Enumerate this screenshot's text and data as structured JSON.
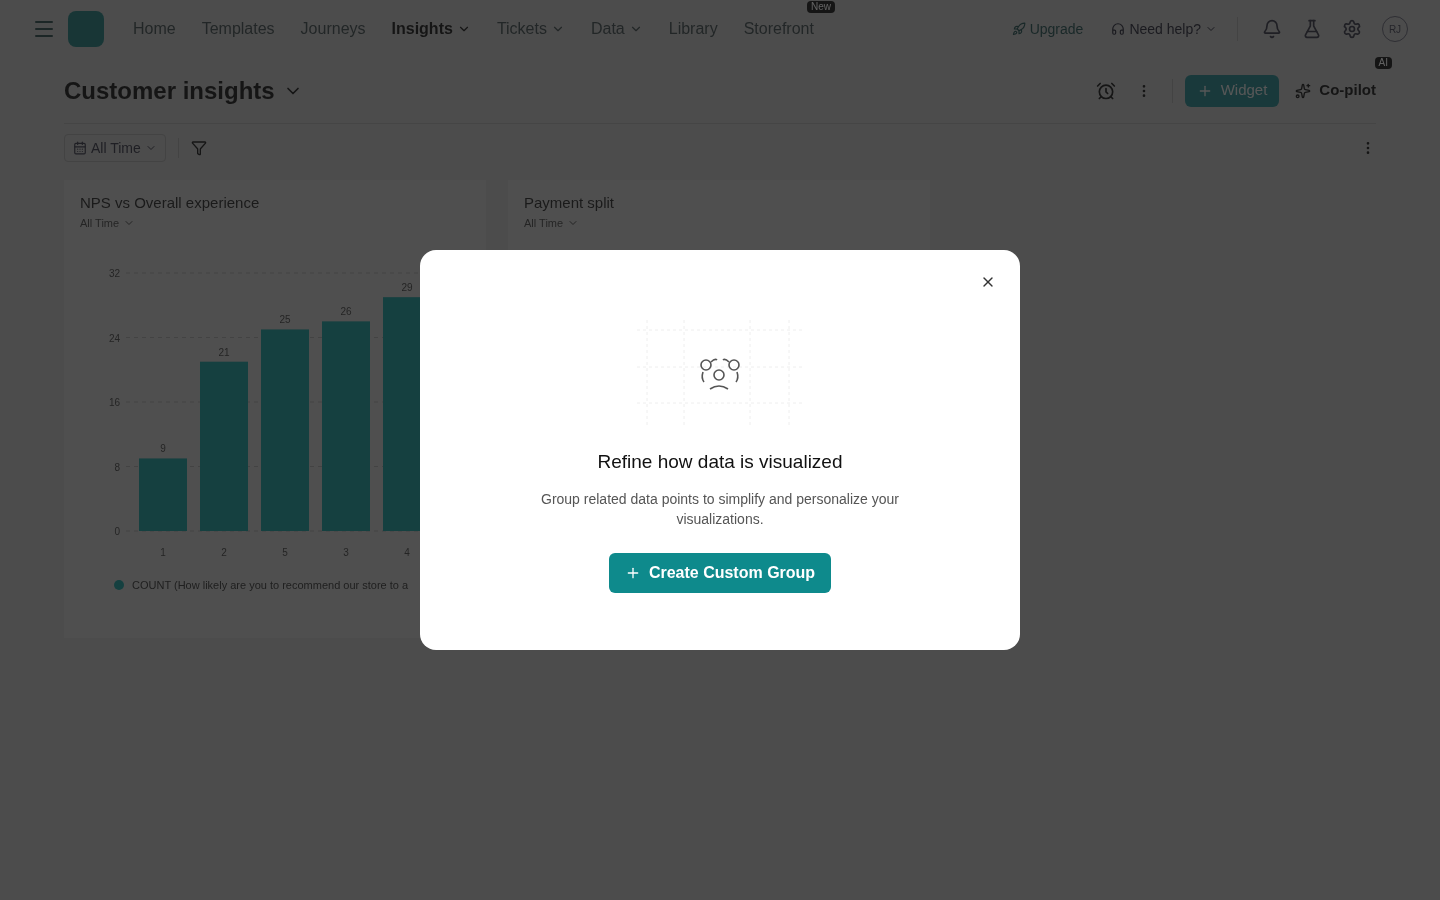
{
  "nav": {
    "items": [
      {
        "label": "Home",
        "selected": false,
        "caret": false
      },
      {
        "label": "Templates",
        "selected": false,
        "caret": false
      },
      {
        "label": "Journeys",
        "selected": false,
        "caret": false
      },
      {
        "label": "Insights",
        "selected": true,
        "caret": true
      },
      {
        "label": "Tickets",
        "selected": false,
        "caret": true
      },
      {
        "label": "Data",
        "selected": false,
        "caret": true
      },
      {
        "label": "Library",
        "selected": false,
        "caret": false
      },
      {
        "label": "Storefront",
        "selected": false,
        "caret": false,
        "badge": "New"
      }
    ],
    "upgrade": "Upgrade",
    "help": "Need help?",
    "avatar": "RJ"
  },
  "header": {
    "title": "Customer insights",
    "widget_button": "Widget",
    "copilot": "Co-pilot",
    "copilot_badge": "AI"
  },
  "filter": {
    "date": "All Time"
  },
  "cards": [
    {
      "title": "NPS vs Overall experience",
      "range": "All Time",
      "chart_data": {
        "type": "bar",
        "categories": [
          "1",
          "2",
          "5",
          "3",
          "4"
        ],
        "yticks": [
          0,
          8,
          16,
          24,
          32
        ],
        "ylim": [
          0,
          32
        ],
        "grid": true,
        "data_labels": true,
        "series": [
          {
            "name": "COUNT (How likely are you to recommend our store to a",
            "color": "#008f8f",
            "values": [
              9,
              21,
              25,
              26,
              29
            ]
          }
        ]
      }
    },
    {
      "title": "Payment split",
      "range": "All Time"
    }
  ],
  "modal": {
    "title": "Refine how data is visualized",
    "text": "Group related data points to simplify and personalize your visualizations.",
    "button": "Create Custom Group"
  }
}
